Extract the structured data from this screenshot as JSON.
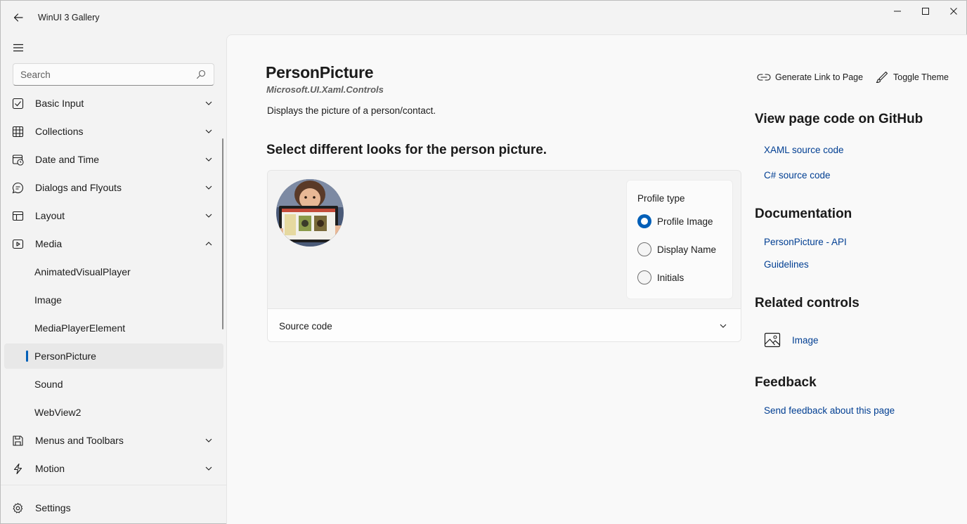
{
  "app": {
    "title": "WinUI 3 Gallery"
  },
  "search": {
    "placeholder": "Search"
  },
  "sidebar": {
    "items": [
      {
        "label": "Basic Input",
        "icon": "checkbox-icon",
        "expanded": false
      },
      {
        "label": "Collections",
        "icon": "grid-icon",
        "expanded": false
      },
      {
        "label": "Date and Time",
        "icon": "calendar-clock-icon",
        "expanded": false
      },
      {
        "label": "Dialogs and Flyouts",
        "icon": "chat-bubble-icon",
        "expanded": false
      },
      {
        "label": "Layout",
        "icon": "layout-icon",
        "expanded": false
      },
      {
        "label": "Media",
        "icon": "media-icon",
        "expanded": true
      },
      {
        "label": "AnimatedVisualPlayer"
      },
      {
        "label": "Image"
      },
      {
        "label": "MediaPlayerElement"
      },
      {
        "label": "PersonPicture",
        "selected": true
      },
      {
        "label": "Sound"
      },
      {
        "label": "WebView2"
      },
      {
        "label": "Menus and Toolbars",
        "icon": "save-icon",
        "expanded": false
      },
      {
        "label": "Motion",
        "icon": "lightning-icon",
        "expanded": false
      }
    ],
    "settings_label": "Settings"
  },
  "page": {
    "title": "PersonPicture",
    "namespace": "Microsoft.UI.Xaml.Controls",
    "description": "Displays the picture of a person/contact.",
    "section_title": "Select different looks for the person picture.",
    "actions": {
      "generate_link": "Generate Link to Page",
      "toggle_theme": "Toggle Theme"
    },
    "example": {
      "options_header": "Profile type",
      "options": [
        {
          "label": "Profile Image",
          "checked": true
        },
        {
          "label": "Display Name",
          "checked": false
        },
        {
          "label": "Initials",
          "checked": false
        }
      ],
      "source_code_label": "Source code"
    }
  },
  "right_panel": {
    "github_heading": "View page code on GitHub",
    "xaml_link": "XAML source code",
    "csharp_link": "C# source code",
    "documentation_heading": "Documentation",
    "api_link": "PersonPicture - API",
    "guidelines_link": "Guidelines",
    "related_heading": "Related controls",
    "related_item": "Image",
    "feedback_heading": "Feedback",
    "feedback_link": "Send feedback about this page"
  },
  "colors": {
    "accent": "#005fb8",
    "link": "#003e92",
    "background": "#f3f3f3"
  }
}
